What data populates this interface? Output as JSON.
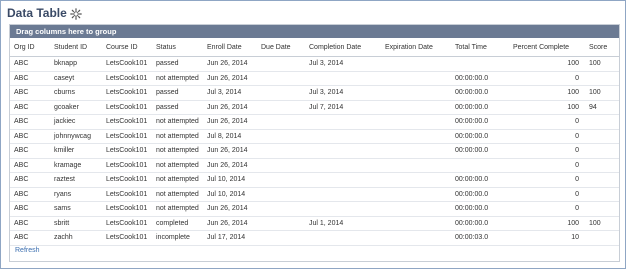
{
  "header": {
    "title": "Data Table",
    "settings_icon": "gear-icon"
  },
  "grid": {
    "group_bar": "Drag columns here to group",
    "columns": [
      "Org ID",
      "Student ID",
      "Course ID",
      "Status",
      "Enroll Date",
      "Due Date",
      "Completion Date",
      "Expiration Date",
      "Total Time",
      "Percent Complete",
      "Score"
    ],
    "rows": [
      [
        "ABC",
        "bknapp",
        "LetsCook101",
        "passed",
        "Jun 26, 2014",
        "",
        "Jul 3, 2014",
        "",
        "",
        "100",
        "100"
      ],
      [
        "ABC",
        "caseyt",
        "LetsCook101",
        "not attempted",
        "Jun 26, 2014",
        "",
        "",
        "",
        "00:00:00.0",
        "0",
        ""
      ],
      [
        "ABC",
        "cburns",
        "LetsCook101",
        "passed",
        "Jul 3, 2014",
        "",
        "Jul 3, 2014",
        "",
        "00:00:00.0",
        "100",
        "100"
      ],
      [
        "ABC",
        "gcoaker",
        "LetsCook101",
        "passed",
        "Jun 26, 2014",
        "",
        "Jul 7, 2014",
        "",
        "00:00:00.0",
        "100",
        "94"
      ],
      [
        "ABC",
        "jackiec",
        "LetsCook101",
        "not attempted",
        "Jun 26, 2014",
        "",
        "",
        "",
        "00:00:00.0",
        "0",
        ""
      ],
      [
        "ABC",
        "johnnywcag",
        "LetsCook101",
        "not attempted",
        "Jul 8, 2014",
        "",
        "",
        "",
        "00:00:00.0",
        "0",
        ""
      ],
      [
        "ABC",
        "kmiller",
        "LetsCook101",
        "not attempted",
        "Jun 26, 2014",
        "",
        "",
        "",
        "00:00:00.0",
        "0",
        ""
      ],
      [
        "ABC",
        "kramage",
        "LetsCook101",
        "not attempted",
        "Jun 26, 2014",
        "",
        "",
        "",
        "",
        "0",
        ""
      ],
      [
        "ABC",
        "raztest",
        "LetsCook101",
        "not attempted",
        "Jul 10, 2014",
        "",
        "",
        "",
        "00:00:00.0",
        "0",
        ""
      ],
      [
        "ABC",
        "ryans",
        "LetsCook101",
        "not attempted",
        "Jul 10, 2014",
        "",
        "",
        "",
        "00:00:00.0",
        "0",
        ""
      ],
      [
        "ABC",
        "sams",
        "LetsCook101",
        "not attempted",
        "Jun 26, 2014",
        "",
        "",
        "",
        "00:00:00.0",
        "0",
        ""
      ],
      [
        "ABC",
        "sbritt",
        "LetsCook101",
        "completed",
        "Jun 26, 2014",
        "",
        "Jul 1, 2014",
        "",
        "00:00:00.0",
        "100",
        "100"
      ],
      [
        "ABC",
        "zachh",
        "LetsCook101",
        "incomplete",
        "Jul 17, 2014",
        "",
        "",
        "",
        "00:00:03.0",
        "10",
        ""
      ]
    ]
  },
  "footer": {
    "refresh_label": "Refresh"
  }
}
